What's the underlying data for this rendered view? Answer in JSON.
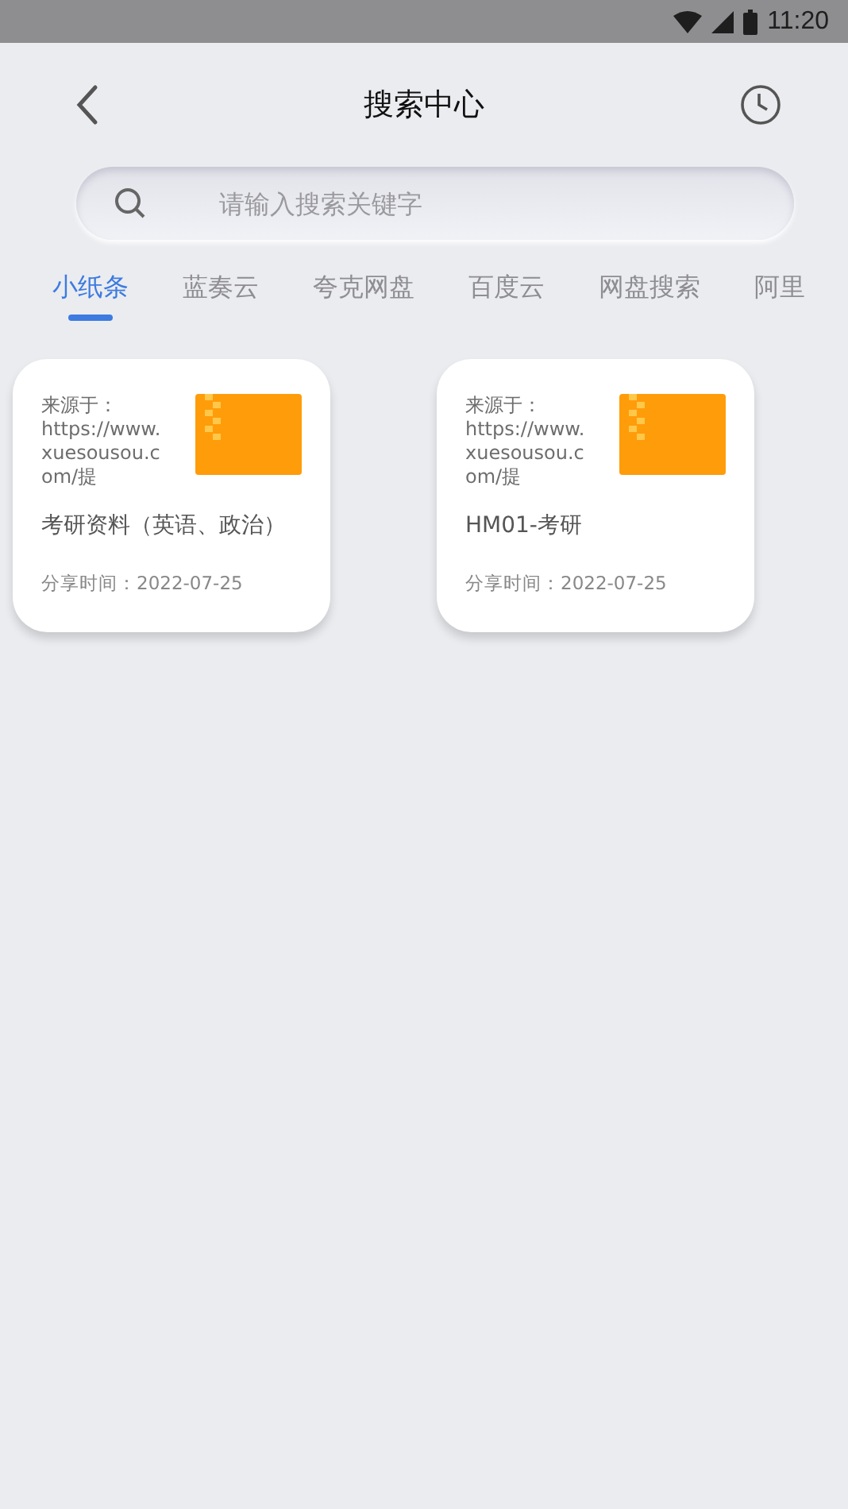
{
  "status_bar": {
    "time": "11:20"
  },
  "header": {
    "title": "搜索中心"
  },
  "search": {
    "placeholder": "请输入搜索关键字"
  },
  "tabs": [
    {
      "label": "小纸条",
      "selected": true
    },
    {
      "label": "蓝奏云",
      "selected": false
    },
    {
      "label": "夸克网盘",
      "selected": false
    },
    {
      "label": "百度云",
      "selected": false
    },
    {
      "label": "网盘搜索",
      "selected": false
    },
    {
      "label": "阿里",
      "selected": false
    }
  ],
  "results": [
    {
      "source": "来源于：https://www.xuesousou.com/提",
      "title": "考研资料（英语、政治）",
      "shared": "分享时间：2022-07-25"
    },
    {
      "source": "来源于：https://www.xuesousou.com/提",
      "title": "HM01-考研",
      "shared": "分享时间：2022-07-25"
    }
  ]
}
